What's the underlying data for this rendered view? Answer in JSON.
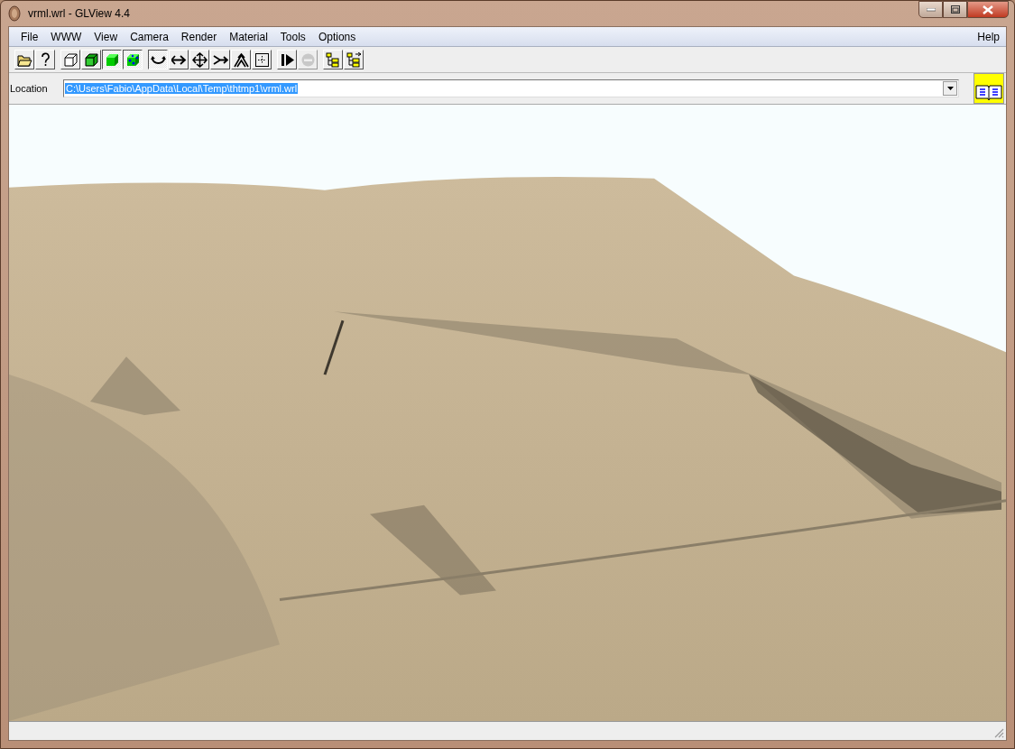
{
  "window": {
    "title": "vrml.wrl - GLView 4.4"
  },
  "menu": [
    {
      "label": "File"
    },
    {
      "label": "WWW"
    },
    {
      "label": "View"
    },
    {
      "label": "Camera"
    },
    {
      "label": "Render"
    },
    {
      "label": "Material"
    },
    {
      "label": "Tools"
    },
    {
      "label": "Options"
    }
  ],
  "help_menu": {
    "label": "Help"
  },
  "toolbar_groups": [
    {
      "buttons": [
        {
          "kind": "open",
          "pressed": false,
          "disabled": false
        },
        {
          "kind": "help",
          "pressed": false,
          "disabled": false
        }
      ]
    },
    {
      "buttons": [
        {
          "kind": "wire",
          "pressed": false,
          "disabled": false
        },
        {
          "kind": "flat",
          "pressed": false,
          "disabled": false
        },
        {
          "kind": "solid",
          "pressed": true,
          "disabled": false
        },
        {
          "kind": "textured",
          "pressed": true,
          "disabled": false
        }
      ]
    },
    {
      "buttons": [
        {
          "kind": "rotate",
          "pressed": true,
          "disabled": false
        },
        {
          "kind": "walk",
          "pressed": false,
          "disabled": false
        },
        {
          "kind": "pan",
          "pressed": false,
          "disabled": false
        },
        {
          "kind": "fly",
          "pressed": false,
          "disabled": false
        },
        {
          "kind": "tilt",
          "pressed": false,
          "disabled": false
        },
        {
          "kind": "fit",
          "pressed": false,
          "disabled": false
        }
      ]
    },
    {
      "buttons": [
        {
          "kind": "play",
          "pressed": false,
          "disabled": false
        },
        {
          "kind": "stop",
          "pressed": false,
          "disabled": true
        }
      ]
    },
    {
      "buttons": [
        {
          "kind": "tree",
          "pressed": false,
          "disabled": false
        },
        {
          "kind": "tree2",
          "pressed": false,
          "disabled": false
        }
      ]
    }
  ],
  "location": {
    "label": "Location",
    "value": "C:\\Users\\Fabio\\AppData\\Local\\Temp\\thtmp1\\vrml.wrl"
  }
}
